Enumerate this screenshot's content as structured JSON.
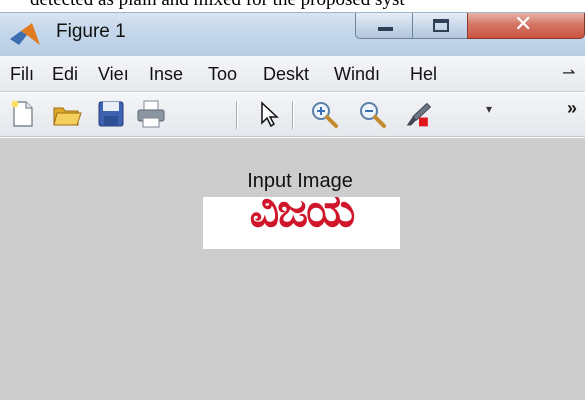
{
  "document": {
    "partial_text": "detected as plain and mixed for the proposed syst"
  },
  "window": {
    "title": "Figure 1",
    "controls": {
      "minimize": "minimize",
      "maximize": "maximize",
      "close": "close"
    }
  },
  "menubar": {
    "items": [
      "Filı",
      "Edi",
      "Vieı",
      "Inse",
      "Too",
      "Deskt",
      "Windı",
      "Hel"
    ],
    "overflow_icon": "chevron-more-icon"
  },
  "toolbar": {
    "tools": [
      {
        "name": "new-figure-icon"
      },
      {
        "name": "open-file-icon"
      },
      {
        "name": "save-figure-icon"
      },
      {
        "name": "print-figure-icon"
      },
      {
        "name": "edit-plot-icon"
      },
      {
        "name": "zoom-in-icon"
      },
      {
        "name": "zoom-out-icon"
      },
      {
        "name": "brush-icon"
      }
    ],
    "dropdown_glyph": "▾",
    "overflow_glyph": "»"
  },
  "figure": {
    "axes_title": "Input Image",
    "image_text": "ವಿಜಯ"
  },
  "colors": {
    "titlebar": "#c4d6ea",
    "canvas": "#cdcdcd",
    "image_text": "#d0162b"
  }
}
